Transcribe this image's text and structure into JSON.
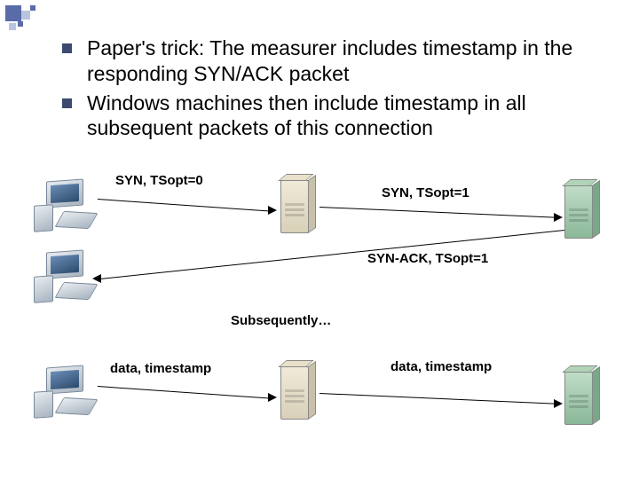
{
  "bullets": [
    "Paper's trick: The measurer includes timestamp in the responding SYN/ACK packet",
    "Windows machines then include timestamp in all subsequent packets of this connection"
  ],
  "labels": {
    "syn0": "SYN, TSopt=0",
    "syn1": "SYN, TSopt=1",
    "synack": "SYN-ACK, TSopt=1",
    "subsequently": "Subsequently…",
    "data1": "data, timestamp",
    "data2": "data, timestamp"
  },
  "chart_data": {
    "type": "diagram",
    "title": "TCP timestamp option trick — SYN/ACK timestamp injection",
    "nodes": [
      {
        "id": "client1",
        "kind": "computer",
        "role": "client"
      },
      {
        "id": "client2",
        "kind": "computer",
        "role": "client"
      },
      {
        "id": "client3",
        "kind": "computer",
        "role": "client"
      },
      {
        "id": "measurer1",
        "kind": "server-beige",
        "role": "measurer"
      },
      {
        "id": "measurer2",
        "kind": "server-beige",
        "role": "measurer"
      },
      {
        "id": "server1",
        "kind": "server-green",
        "role": "server"
      },
      {
        "id": "server2",
        "kind": "server-green",
        "role": "server"
      }
    ],
    "edges": [
      {
        "from": "client1",
        "to": "measurer1",
        "label": "SYN, TSopt=0",
        "direction": "right"
      },
      {
        "from": "measurer1",
        "to": "server1",
        "label": "SYN, TSopt=1",
        "direction": "right"
      },
      {
        "from": "server1",
        "to": "client2",
        "label": "SYN-ACK, TSopt=1",
        "direction": "left"
      },
      {
        "from": "client3",
        "to": "measurer2",
        "label": "data, timestamp",
        "direction": "right"
      },
      {
        "from": "measurer2",
        "to": "server2",
        "label": "data, timestamp",
        "direction": "right"
      }
    ],
    "annotations": [
      "Subsequently…"
    ]
  }
}
